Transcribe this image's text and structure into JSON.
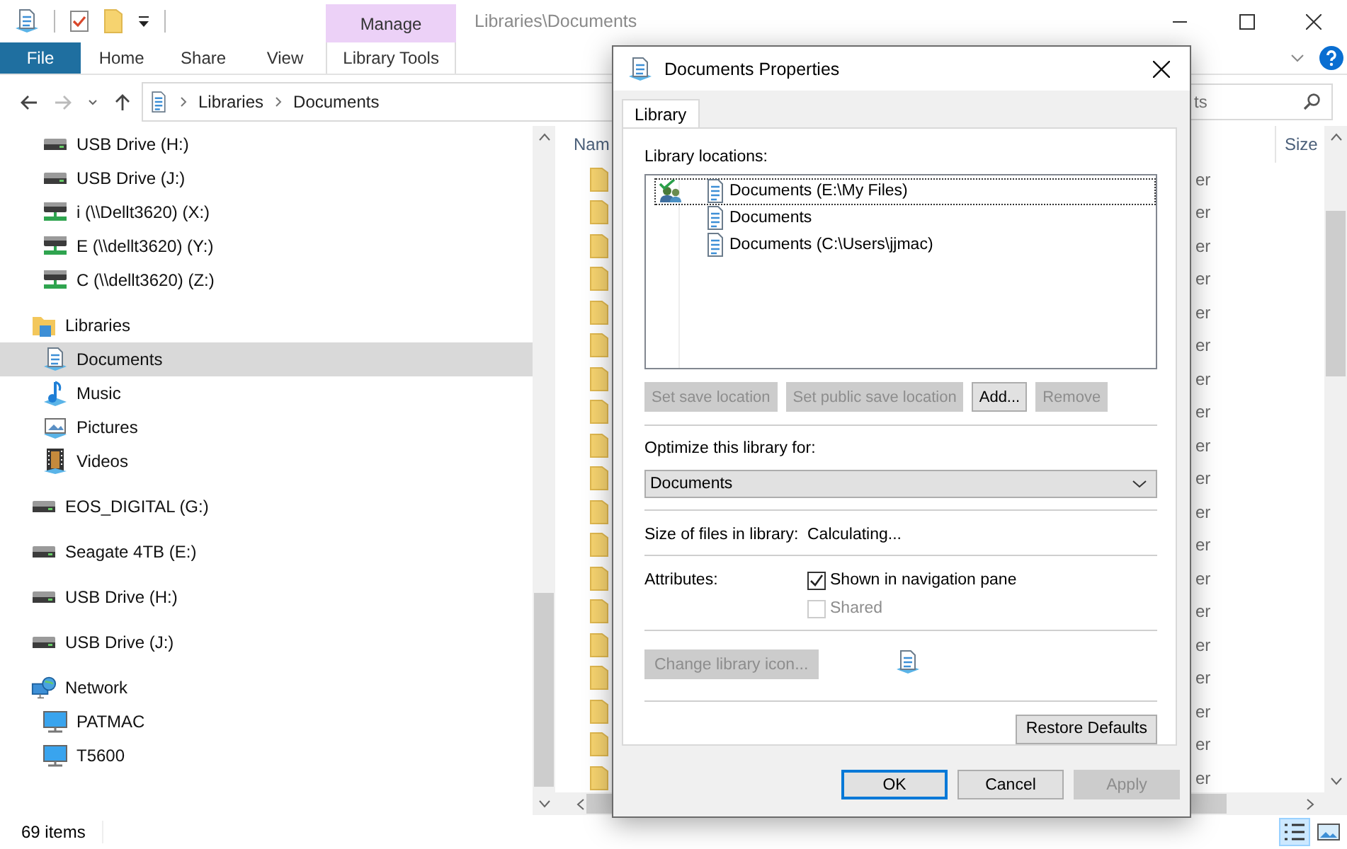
{
  "title_bar": {
    "context_tab": "Manage",
    "title": "Libraries\\Documents"
  },
  "ribbon_tabs": [
    {
      "label": "File",
      "kind": "file"
    },
    {
      "label": "Home",
      "kind": "tab"
    },
    {
      "label": "Share",
      "kind": "tab"
    },
    {
      "label": "View",
      "kind": "tab"
    },
    {
      "label": "Library Tools",
      "kind": "context"
    }
  ],
  "address_bar": {
    "path": [
      "Libraries",
      "Documents"
    ]
  },
  "search": {
    "placeholder": "ts"
  },
  "nav_pane": {
    "items": [
      {
        "children": [
          {
            "label": "USB Drive (H:)",
            "kind": "drive",
            "selected": false
          },
          {
            "label": "USB Drive (J:)",
            "kind": "drive",
            "selected": false
          },
          {
            "label": "i (\\\\Dellt3620) (X:)",
            "kind": "network-drive",
            "selected": false
          },
          {
            "label": "E (\\\\dellt3620) (Y:)",
            "kind": "network-drive",
            "selected": false
          },
          {
            "label": "C (\\\\dellt3620) (Z:)",
            "kind": "network-drive",
            "selected": false
          }
        ]
      },
      {
        "label": "Libraries",
        "kind": "library",
        "selected": false,
        "children": [
          {
            "label": "Documents",
            "kind": "documents",
            "selected": true
          },
          {
            "label": "Music",
            "kind": "music",
            "selected": false
          },
          {
            "label": "Pictures",
            "kind": "pictures",
            "selected": false
          },
          {
            "label": "Videos",
            "kind": "videos",
            "selected": false
          }
        ]
      },
      {
        "label": "EOS_DIGITAL (G:)",
        "kind": "drive",
        "selected": false
      },
      {
        "label": "Seagate 4TB (E:)",
        "kind": "drive",
        "selected": false
      },
      {
        "label": "USB Drive (H:)",
        "kind": "drive",
        "selected": false
      },
      {
        "label": "USB Drive (J:)",
        "kind": "drive",
        "selected": false
      },
      {
        "label": "Network",
        "kind": "network",
        "selected": false,
        "children": [
          {
            "label": "PATMAC",
            "kind": "computer",
            "selected": false
          },
          {
            "label": "T5600",
            "kind": "computer",
            "selected": false
          }
        ]
      }
    ]
  },
  "file_list": {
    "columns": [
      "Nam",
      "Size"
    ],
    "rows": [
      {
        "column_3": "er"
      },
      {
        "column_3": "er"
      },
      {
        "column_3": "er"
      },
      {
        "column_3": "er"
      },
      {
        "column_3": "er"
      },
      {
        "column_3": "er"
      },
      {
        "column_3": "er"
      },
      {
        "column_3": "er"
      },
      {
        "column_3": "er"
      },
      {
        "column_3": "er"
      },
      {
        "column_3": "er"
      },
      {
        "column_3": "er"
      },
      {
        "column_3": "er"
      },
      {
        "column_3": "er"
      },
      {
        "column_3": "er"
      },
      {
        "column_3": "er"
      },
      {
        "column_3": "er"
      },
      {
        "column_3": "er"
      },
      {
        "column_3": "er"
      }
    ]
  },
  "status_bar": {
    "item_count": "69 items"
  },
  "dialog": {
    "title": "Documents Properties",
    "tabs": [
      {
        "label": "Library",
        "selected": true
      }
    ],
    "locations_label": "Library locations:",
    "locations": [
      {
        "label": "Documents (E:\\My Files)",
        "save_location": true,
        "selected": true
      },
      {
        "label": "Documents",
        "save_location": false,
        "selected": false
      },
      {
        "label": "Documents (C:\\Users\\jjmac)",
        "save_location": false,
        "selected": false
      }
    ],
    "location_buttons": [
      {
        "label": "Set save location",
        "disabled": true
      },
      {
        "label": "Set public save location",
        "disabled": true
      },
      {
        "label": "Add...",
        "disabled": false
      },
      {
        "label": "Remove",
        "disabled": true
      }
    ],
    "optimize_label": "Optimize this library for:",
    "optimize_value": "Documents",
    "size_label": "Size of files in library:",
    "size_value": "Calculating...",
    "attributes_label": "Attributes:",
    "attributes": [
      {
        "label": "Shown in navigation pane",
        "checked": true,
        "disabled": false
      },
      {
        "label": "Shared",
        "checked": false,
        "disabled": true
      }
    ],
    "change_icon_button": {
      "label": "Change library icon...",
      "disabled": true
    },
    "restore_button": {
      "label": "Restore Defaults",
      "disabled": false
    },
    "footer_buttons": [
      {
        "label": "OK",
        "default": true,
        "disabled": false
      },
      {
        "label": "Cancel",
        "default": false,
        "disabled": false
      },
      {
        "label": "Apply",
        "default": false,
        "disabled": true
      }
    ]
  }
}
